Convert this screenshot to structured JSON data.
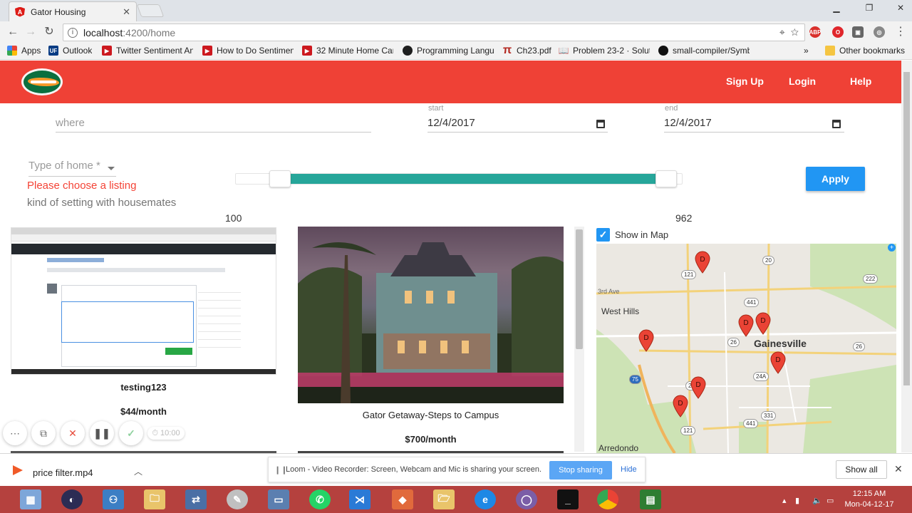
{
  "browser": {
    "tab_title": "Gator Housing",
    "url_host": "localhost",
    "url_path": ":4200/home",
    "bookmarks": [
      {
        "label": "Apps",
        "color": "#4285f4"
      },
      {
        "label": "Outlook",
        "color": "#0a3c84"
      },
      {
        "label": "Twitter Sentiment An",
        "color": "#cc181e"
      },
      {
        "label": "How to Do Sentimen",
        "color": "#cc181e"
      },
      {
        "label": "32 Minute Home Car",
        "color": "#cc181e"
      },
      {
        "label": "Programming Langu",
        "color": "#1e1e1e"
      },
      {
        "label": "Ch23.pdf",
        "color": "#b3261e"
      },
      {
        "label": "Problem 23-2 · Solut",
        "color": "#333333"
      },
      {
        "label": "small-compiler/Symb",
        "color": "#111111"
      }
    ],
    "other_bookmarks": "Other bookmarks"
  },
  "header": {
    "nav": [
      "Sign Up",
      "Login",
      "Help"
    ],
    "color": "#ef4136"
  },
  "search": {
    "where_placeholder": "where",
    "start_label": "start",
    "start_value": "12/4/2017",
    "end_label": "end",
    "end_value": "12/4/2017",
    "type_placeholder": "Type of home *",
    "type_error": "Please choose a listing",
    "type_hint": "kind of setting with housemates",
    "slider_min": "100",
    "slider_max": "962",
    "apply_label": "Apply",
    "accent": "#26a69a"
  },
  "listings": [
    {
      "title": "testing123",
      "price": "$44/month"
    },
    {
      "title": "Gator Getaway-Steps to Campus",
      "price": "$700/month"
    }
  ],
  "map": {
    "show_label": "Show in Map",
    "checked": true,
    "places": [
      "West Hills",
      "Gainesville",
      "Arredondo",
      "3rd Ave"
    ],
    "marker_letter": "D"
  },
  "recorder": {
    "timer": "10:00"
  },
  "download": {
    "file": "price filter.mp4",
    "share_text": "Loom - Video Recorder: Screen, Webcam and Mic is sharing your screen.",
    "stop_label": "Stop sharing",
    "hide_label": "Hide",
    "show_all_label": "Show all"
  },
  "taskbar": {
    "time": "12:15 AM",
    "date": "Mon-04-12-17"
  }
}
